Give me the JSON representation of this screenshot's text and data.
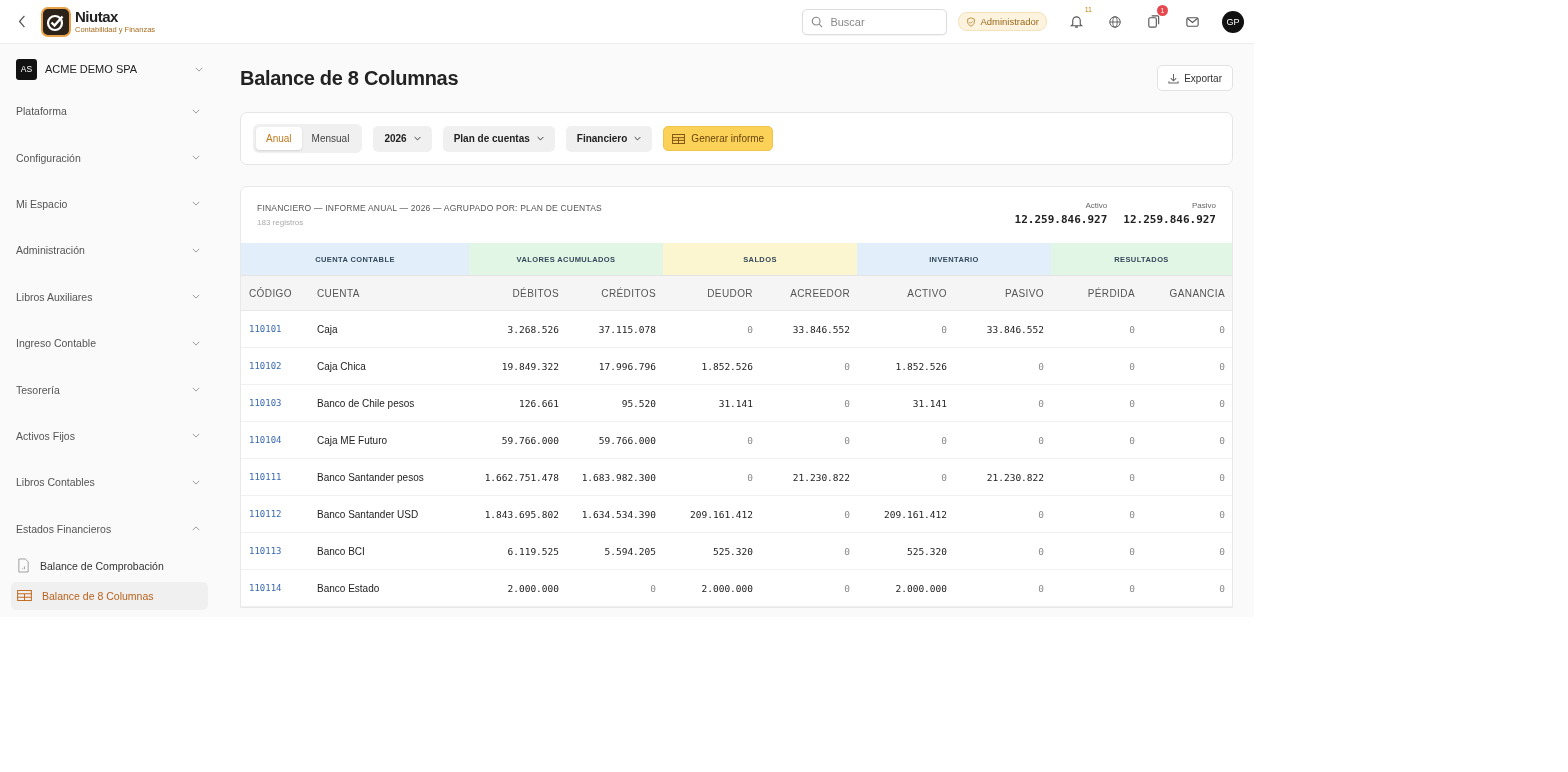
{
  "header": {
    "brand": {
      "name": "Niutax",
      "tagline": "Contabilidad y Finanzas"
    },
    "search": {
      "placeholder": "Buscar"
    },
    "role_badge": "Administrador",
    "notifications": {
      "count": "11"
    },
    "tasks": {
      "count": "1"
    },
    "avatar": "GP"
  },
  "sidebar": {
    "company": {
      "initials": "AS",
      "name": "ACME DEMO SPA"
    },
    "sections": [
      {
        "label": "Plataforma",
        "expanded": false
      },
      {
        "label": "Configuración",
        "expanded": false
      },
      {
        "label": "Mi Espacio",
        "expanded": false
      },
      {
        "label": "Administración",
        "expanded": false
      },
      {
        "label": "Libros Auxiliares",
        "expanded": false
      },
      {
        "label": "Ingreso Contable",
        "expanded": false
      },
      {
        "label": "Tesorería",
        "expanded": false
      },
      {
        "label": "Activos Fijos",
        "expanded": false
      },
      {
        "label": "Libros Contables",
        "expanded": false
      },
      {
        "label": "Estados Financieros",
        "expanded": true,
        "children": [
          {
            "label": "Balance de Comprobación",
            "kind": "document",
            "selected": false
          },
          {
            "label": "Balance de 8 Columnas",
            "kind": "table",
            "selected": true
          }
        ]
      }
    ]
  },
  "page": {
    "title": "Balance de 8 Columnas",
    "export_button": "Exportar"
  },
  "filters": {
    "periods": [
      {
        "label": "Anual",
        "selected": true
      },
      {
        "label": "Mensual",
        "selected": false
      }
    ],
    "dropdowns": [
      "2026",
      "Plan de cuentas",
      "Financiero"
    ],
    "generate_button": "Generar informe"
  },
  "report": {
    "summary": "FINANCIERO — INFORME ANUAL — 2026 — AGRUPADO POR: PLAN DE CUENTAS",
    "count": "183 registros",
    "totals": [
      {
        "label": "Activo",
        "value": "12.259.846.927"
      },
      {
        "label": "Pasivo",
        "value": "12.259.846.927"
      }
    ],
    "groups": [
      {
        "label": "CUENTA CONTABLE",
        "color": "#e2effb"
      },
      {
        "label": "VALORES ACUMULADOS",
        "color": "#e1f6e5"
      },
      {
        "label": "SALDOS",
        "color": "#fbf6cf"
      },
      {
        "label": "INVENTARIO",
        "color": "#e2effb"
      },
      {
        "label": "RESULTADOS",
        "color": "#e1f6e5"
      }
    ],
    "columns": [
      "CÓDIGO",
      "CUENTA",
      "DÉBITOS",
      "CRÉDITOS",
      "DEUDOR",
      "ACREEDOR",
      "ACTIVO",
      "PASIVO",
      "PÉRDIDA",
      "GANANCIA"
    ],
    "rows": [
      {
        "code": "110101",
        "account": "Caja",
        "values": [
          "3.268.526",
          "37.115.078",
          "0",
          "33.846.552",
          "0",
          "33.846.552",
          "0",
          "0"
        ],
        "muted": [
          false,
          false,
          true,
          false,
          true,
          false,
          true,
          true
        ]
      },
      {
        "code": "110102",
        "account": "Caja Chica",
        "values": [
          "19.849.322",
          "17.996.796",
          "1.852.526",
          "0",
          "1.852.526",
          "0",
          "0",
          "0"
        ],
        "muted": [
          false,
          false,
          false,
          true,
          false,
          true,
          true,
          true
        ]
      },
      {
        "code": "110103",
        "account": "Banco de Chile pesos",
        "values": [
          "126.661",
          "95.520",
          "31.141",
          "0",
          "31.141",
          "0",
          "0",
          "0"
        ],
        "muted": [
          false,
          false,
          false,
          true,
          false,
          true,
          true,
          true
        ]
      },
      {
        "code": "110104",
        "account": "Caja ME Futuro",
        "values": [
          "59.766.000",
          "59.766.000",
          "0",
          "0",
          "0",
          "0",
          "0",
          "0"
        ],
        "muted": [
          false,
          false,
          true,
          true,
          true,
          true,
          true,
          true
        ]
      },
      {
        "code": "110111",
        "account": "Banco Santander pesos",
        "values": [
          "1.662.751.478",
          "1.683.982.300",
          "0",
          "21.230.822",
          "0",
          "21.230.822",
          "0",
          "0"
        ],
        "muted": [
          false,
          false,
          true,
          false,
          true,
          false,
          true,
          true
        ]
      },
      {
        "code": "110112",
        "account": "Banco Santander USD",
        "values": [
          "1.843.695.802",
          "1.634.534.390",
          "209.161.412",
          "0",
          "209.161.412",
          "0",
          "0",
          "0"
        ],
        "muted": [
          false,
          false,
          false,
          true,
          false,
          true,
          true,
          true
        ]
      },
      {
        "code": "110113",
        "account": "Banco BCI",
        "values": [
          "6.119.525",
          "5.594.205",
          "525.320",
          "0",
          "525.320",
          "0",
          "0",
          "0"
        ],
        "muted": [
          false,
          false,
          false,
          true,
          false,
          true,
          true,
          true
        ]
      },
      {
        "code": "110114",
        "account": "Banco Estado",
        "values": [
          "2.000.000",
          "0",
          "2.000.000",
          "0",
          "2.000.000",
          "0",
          "0",
          "0"
        ],
        "muted": [
          false,
          true,
          false,
          true,
          false,
          true,
          true,
          true
        ]
      }
    ]
  }
}
